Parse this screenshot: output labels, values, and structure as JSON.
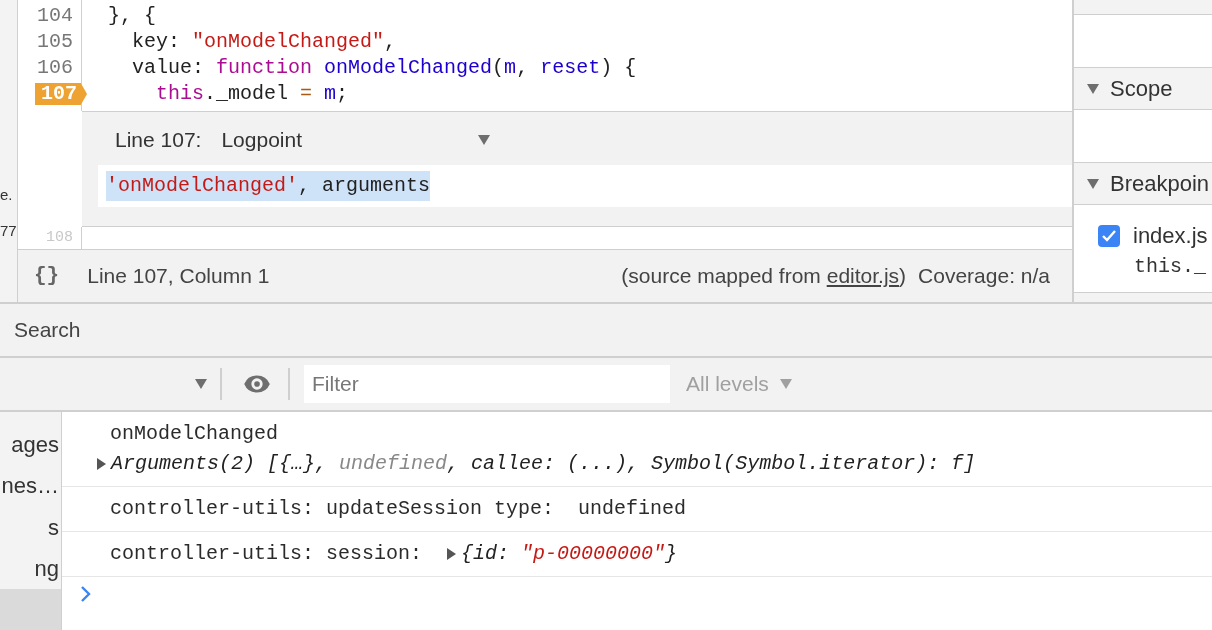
{
  "left_strip": {
    "fragments": [
      "e.",
      "77"
    ]
  },
  "editor": {
    "lines": [
      {
        "number": "104",
        "breakpoint": false,
        "tokens": [
          {
            "text": " }, {",
            "kind": "plain"
          }
        ]
      },
      {
        "number": "105",
        "breakpoint": false,
        "tokens": [
          {
            "text": "   key: ",
            "kind": "plain"
          },
          {
            "text": "\"onModelChanged\"",
            "kind": "string"
          },
          {
            "text": ",",
            "kind": "plain"
          }
        ]
      },
      {
        "number": "106",
        "breakpoint": false,
        "tokens": [
          {
            "text": "   value: ",
            "kind": "plain"
          },
          {
            "text": "function ",
            "kind": "keyword"
          },
          {
            "text": "onModelChanged",
            "kind": "name"
          },
          {
            "text": "(",
            "kind": "plain"
          },
          {
            "text": "m",
            "kind": "name"
          },
          {
            "text": ", ",
            "kind": "plain"
          },
          {
            "text": "reset",
            "kind": "name"
          },
          {
            "text": ") {",
            "kind": "plain"
          }
        ]
      },
      {
        "number": "107",
        "breakpoint": true,
        "tokens": [
          {
            "text": "     this",
            "kind": "keyword"
          },
          {
            "text": "._model ",
            "kind": "plain"
          },
          {
            "text": "=",
            "kind": "operator"
          },
          {
            "text": " m",
            "kind": "name"
          },
          {
            "text": ";",
            "kind": "plain"
          }
        ]
      }
    ],
    "logpoint": {
      "line_label": "Line 107:",
      "type": "Logpoint",
      "expression": [
        {
          "text": "'onModelChanged'",
          "kind": "string"
        },
        {
          "text": ", arguments",
          "kind": "plain"
        }
      ]
    },
    "next_line_number": "108"
  },
  "status_bar": {
    "format_icon": "{}",
    "position": "Line 107, Column 1",
    "source_prefix": "(source mapped from ",
    "source_link": "editor.js",
    "source_suffix": ")",
    "coverage": "Coverage: n/a"
  },
  "sidebar": {
    "sections": [
      {
        "title": "Scope",
        "expanded": true
      },
      {
        "title": "Breakpoin",
        "expanded": true
      }
    ],
    "breakpoints": [
      {
        "file": "index.js",
        "code": "this._",
        "checked": true
      }
    ]
  },
  "drawer": {
    "tab": "Search"
  },
  "console_toolbar": {
    "filter_placeholder": "Filter",
    "levels": "All levels"
  },
  "console_sidebar": {
    "items": [
      {
        "label": "ages",
        "selected": false
      },
      {
        "label": "nes…",
        "selected": false
      },
      {
        "label": "s",
        "selected": false
      },
      {
        "label": "ng",
        "selected": false
      },
      {
        "selected": true
      }
    ]
  },
  "messages": [
    {
      "lines": [
        [
          {
            "text": "onModelChanged",
            "kind": "plain"
          }
        ],
        [
          {
            "kind": "expander"
          },
          {
            "text": "Arguments(2) [{…}, ",
            "kind": "italic"
          },
          {
            "text": "undefined",
            "kind": "muted"
          },
          {
            "text": ", callee: (...), Symbol(Symbol.iterator): f]",
            "kind": "italic"
          }
        ]
      ]
    },
    {
      "lines": [
        [
          {
            "text": "controller-utils: updateSession type:  undefined",
            "kind": "plain"
          }
        ]
      ]
    },
    {
      "lines": [
        [
          {
            "text": "controller-utils: session:  ",
            "kind": "plain"
          },
          {
            "kind": "expander"
          },
          {
            "text": "{id: ",
            "kind": "italic"
          },
          {
            "text": "\"p-00000000\"",
            "kind": "string_italic"
          },
          {
            "text": "}",
            "kind": "italic"
          }
        ]
      ]
    }
  ]
}
